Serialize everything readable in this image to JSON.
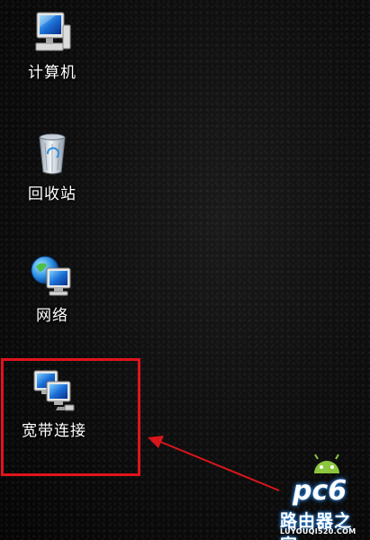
{
  "desktop": {
    "icons": [
      {
        "label": "计算机",
        "icon": "computer-icon"
      },
      {
        "label": "回收站",
        "icon": "recycle-bin-icon"
      },
      {
        "label": "网络",
        "icon": "network-icon"
      },
      {
        "label": "宽带连接",
        "icon": "broadband-connection-icon"
      }
    ]
  },
  "annotation": {
    "highlight_color": "#e0141a",
    "highlighted_item": "宽带连接"
  },
  "watermark": {
    "logo": "pc6",
    "site_name": "路由器之家",
    "url": "LUYOUQI520.COM",
    "mascot": "android-robot-icon"
  }
}
